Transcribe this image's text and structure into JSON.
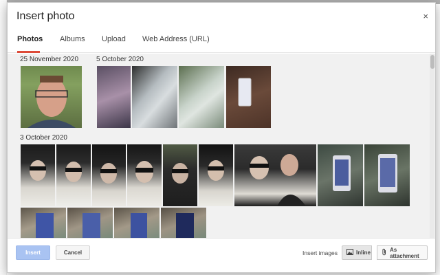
{
  "dialog": {
    "title": "Insert photo",
    "close_icon": "close-icon",
    "close_glyph": "×"
  },
  "tabs": [
    {
      "label": "Photos",
      "active": true
    },
    {
      "label": "Albums",
      "active": false
    },
    {
      "label": "Upload",
      "active": false
    },
    {
      "label": "Web Address (URL)",
      "active": false
    }
  ],
  "groups": [
    {
      "date": "25 November 2020"
    },
    {
      "date": "5 October 2020"
    },
    {
      "date": "3 October 2020"
    }
  ],
  "footer": {
    "insert_label": "Insert",
    "cancel_label": "Cancel",
    "insert_images_label": "Insert images",
    "inline_label": "Inline",
    "attachment_label": "As attachment",
    "inline_icon": "image-icon",
    "attachment_icon": "paperclip-icon"
  },
  "colors": {
    "accent_tab_underline": "#dd4b39",
    "insert_button": "#a9c3f2"
  }
}
